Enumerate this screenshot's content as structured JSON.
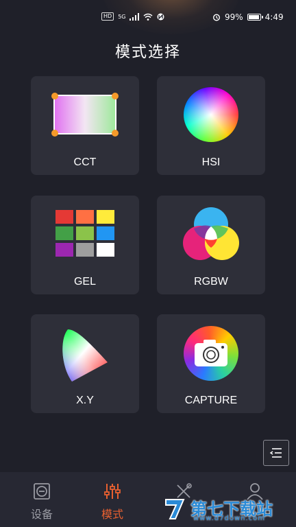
{
  "status": {
    "hd": "HD",
    "network": "5G",
    "battery": "99%",
    "time": "4:49",
    "battery_level": 0.99
  },
  "title": "模式选择",
  "modes": [
    {
      "label": "CCT",
      "icon": "cct-gradient-icon"
    },
    {
      "label": "HSI",
      "icon": "color-wheel-icon"
    },
    {
      "label": "GEL",
      "icon": "gel-swatch-grid-icon"
    },
    {
      "label": "RGBW",
      "icon": "rgb-venn-icon"
    },
    {
      "label": "X.Y",
      "icon": "chromaticity-diagram-icon"
    },
    {
      "label": "CAPTURE",
      "icon": "camera-icon"
    }
  ],
  "gel_colors": [
    "#e53935",
    "#ff7043",
    "#ffeb3b",
    "#43a047",
    "#8bc34a",
    "#2196f3",
    "#9c27b0",
    "#9e9e9e",
    "#ffffff"
  ],
  "tabs": [
    {
      "label": "设备",
      "icon": "device-icon",
      "active": false
    },
    {
      "label": "模式",
      "icon": "sliders-icon",
      "active": true
    },
    {
      "label": "",
      "icon": "effects-icon",
      "active": false
    },
    {
      "label": "",
      "icon": "user-icon",
      "active": false
    }
  ],
  "watermark": {
    "text": "第七下载站",
    "url": "www.d7down.com"
  },
  "colors": {
    "accent": "#e86030",
    "background": "#1f2029",
    "card": "#2e2f39"
  }
}
